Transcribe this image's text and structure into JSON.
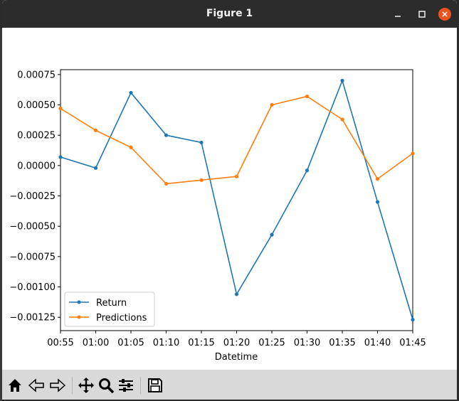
{
  "window": {
    "title": "Figure 1"
  },
  "toolbar": {
    "buttons": [
      "home-icon",
      "back-icon",
      "forward-icon",
      "pan-icon",
      "zoom-icon",
      "configure-subplots-icon",
      "save-icon"
    ]
  },
  "colors": {
    "return": "#1f77b4",
    "predictions": "#ff7f0e",
    "titlebar": "#2c2c2c",
    "close": "#e95420",
    "toolbar": "#d9d9d9"
  },
  "chart_data": {
    "type": "line",
    "title": "",
    "xlabel": "Datetime",
    "ylabel": "",
    "categories": [
      "00:55",
      "01:00",
      "01:05",
      "01:10",
      "01:15",
      "01:20",
      "01:25",
      "01:30",
      "01:35",
      "01:40",
      "01:45"
    ],
    "yticks": [
      "0.00075",
      "0.00050",
      "0.00025",
      "0.00000",
      "−0.00025",
      "−0.00050",
      "−0.00075",
      "−0.00100",
      "−0.00125"
    ],
    "ylim": [
      -0.00136,
      0.00079
    ],
    "legend_position": "lower-left",
    "grid": false,
    "series": [
      {
        "name": "Return",
        "values": [
          7e-05,
          -2e-05,
          0.0006,
          0.00025,
          0.00019,
          -0.00106,
          -0.00057,
          -4e-05,
          0.0007,
          -0.0003,
          -0.00127
        ]
      },
      {
        "name": "Predictions",
        "values": [
          0.00047,
          0.00029,
          0.00015,
          -0.00015,
          -0.00012,
          -9e-05,
          0.0005,
          0.00057,
          0.00038,
          -0.00011,
          0.0001
        ]
      }
    ]
  }
}
